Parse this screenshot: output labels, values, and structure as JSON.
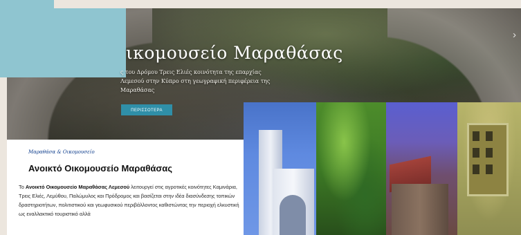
{
  "hero": {
    "title": "ικομουσείο Μαραθάσας",
    "description": "ς του Δρόμου Τρεις Ελιές κοινότητα της επαρχίας Λεμεσού στην Κύπρο στη γεωγραφική περιφέρεια της Μαραθάσας",
    "button_label": "ΠΕΡΙΣΣΟΤΕΡΑ",
    "next_arrow": "›"
  },
  "content": {
    "breadcrumb": "Μαραθάσα & Οικομουσείο",
    "title": "Ανοικτό Οικομουσείο Μαραθάσας",
    "body_intro": "Το ",
    "body_bold": "Ανοικτό Οικομουσείο Μαραθάσας Λεμεσού",
    "body_rest": " λειτουργεί στις αγροτικές κοινότητες Καμινάρια, Τρεις Ελιές, Λεμύθου, Παλώμυλος και Πρόδρομος και βασίζεται στην ιδέα διασύνδεσης τοπικών δραστηριοτήτων, πολιτιστικού και γεωφυσικού περιβάλλοντος καθιστώντας την περιοχή ελκυστική ως εναλλακτικό τουριστικό αλλά"
  },
  "colors": {
    "accent": "#2f8fa8",
    "panel": "#8fc5d0",
    "breadcrumb": "#0e3d8c"
  }
}
